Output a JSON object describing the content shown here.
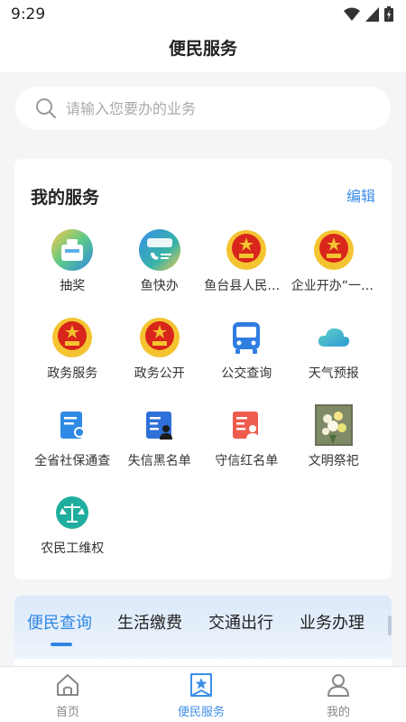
{
  "status_bar": {
    "time": "9:29"
  },
  "header": {
    "title": "便民服务"
  },
  "search": {
    "placeholder": "请输入您要办的业务"
  },
  "my_services": {
    "title": "我的服务",
    "edit_label": "编辑",
    "items": [
      {
        "label": "抽奖",
        "icon": "lottery-gift-icon"
      },
      {
        "label": "鱼快办",
        "icon": "yukuaiban-logo-icon"
      },
      {
        "label": "鱼台县人民政府",
        "icon": "national-emblem-icon"
      },
      {
        "label": "企业开办“一网通办”",
        "icon": "national-emblem-icon"
      },
      {
        "label": "政务服务",
        "icon": "national-emblem-icon"
      },
      {
        "label": "政务公开",
        "icon": "national-emblem-icon"
      },
      {
        "label": "公交查询",
        "icon": "bus-icon"
      },
      {
        "label": "天气预报",
        "icon": "cloud-icon"
      },
      {
        "label": "全省社保通查",
        "icon": "document-badge-icon"
      },
      {
        "label": "失信黑名单",
        "icon": "blacklist-card-icon"
      },
      {
        "label": "守信红名单",
        "icon": "redlist-card-icon"
      },
      {
        "label": "文明祭祀",
        "icon": "flowers-photo-icon"
      },
      {
        "label": "农民工维权",
        "icon": "scales-icon"
      }
    ]
  },
  "tabs": [
    {
      "label": "便民查询",
      "active": true
    },
    {
      "label": "生活缴费",
      "active": false
    },
    {
      "label": "交通出行",
      "active": false
    },
    {
      "label": "业务办理",
      "active": false
    }
  ],
  "bottom_nav": [
    {
      "label": "首页",
      "icon": "home-icon",
      "active": false
    },
    {
      "label": "便民服务",
      "icon": "service-star-icon",
      "active": true
    },
    {
      "label": "我的",
      "icon": "user-icon",
      "active": false
    }
  ],
  "colors": {
    "accent": "#2f86e2",
    "edit": "#3c8ee8",
    "emblem_red": "#d8261c",
    "emblem_gold": "#f4c430"
  }
}
